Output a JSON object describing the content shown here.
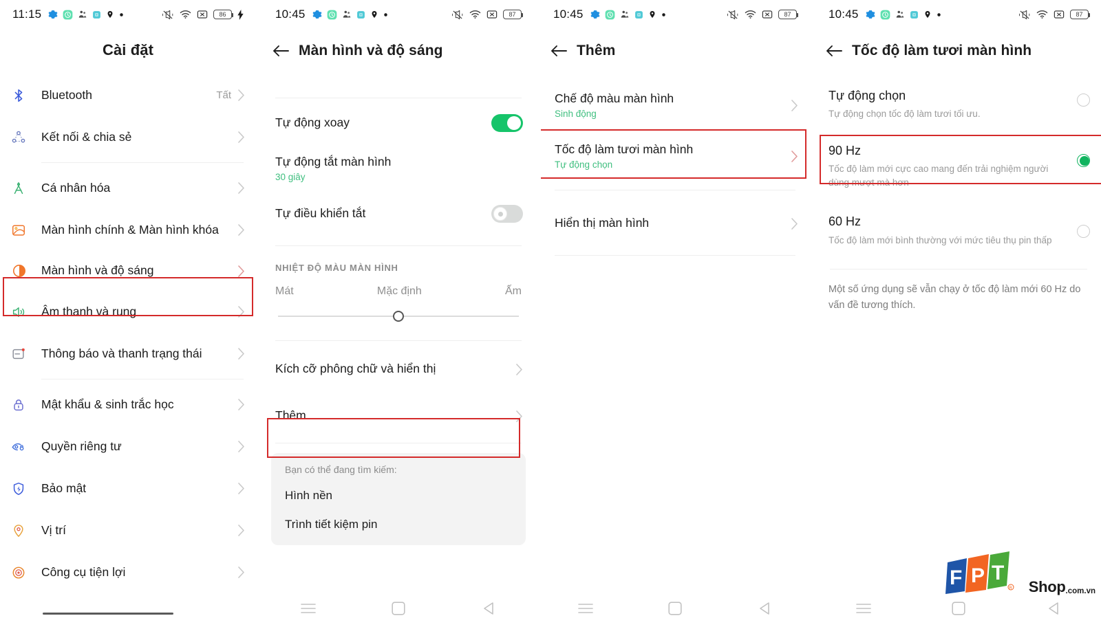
{
  "statusbars": {
    "panel1": {
      "time": "11:15",
      "battery": "86",
      "charging": true,
      "left_icons": [
        "gear-icon",
        "green-circle-icon",
        "people-icon",
        "teal-square-icon",
        "location-pin-icon",
        "dot-icon"
      ],
      "right_icons": [
        "mute-icon",
        "wifi-icon",
        "no-sim-icon",
        "battery-icon",
        "bolt-icon"
      ]
    },
    "panel2": {
      "time": "10:45",
      "battery": "87",
      "charging": false,
      "left_icons": [
        "gear-icon",
        "green-circle-icon",
        "people-icon",
        "teal-square-icon",
        "location-pin-icon",
        "dot-icon"
      ],
      "right_icons": [
        "mute-icon",
        "wifi-icon",
        "no-sim-icon",
        "battery-icon"
      ]
    },
    "panel3": {
      "time": "10:45",
      "battery": "87",
      "charging": false
    },
    "panel4": {
      "time": "10:45",
      "battery": "87",
      "charging": false
    }
  },
  "panel1": {
    "title": "Cài đặt",
    "items": [
      {
        "label": "Bluetooth",
        "value": "Tất",
        "icon": "bluetooth-icon"
      },
      {
        "label": "Kết nối & chia sẻ",
        "value": "",
        "icon": "connection-share-icon"
      },
      {
        "label": "Cá nhân hóa",
        "value": "",
        "icon": "compass-icon"
      },
      {
        "label": "Màn hình chính & Màn hình khóa",
        "value": "",
        "icon": "wallpaper-icon"
      },
      {
        "label": "Màn hình và độ sáng",
        "value": "",
        "icon": "brightness-icon"
      },
      {
        "label": "Âm thanh và rung",
        "value": "",
        "icon": "speaker-icon"
      },
      {
        "label": "Thông báo và thanh trạng thái",
        "value": "",
        "icon": "notification-icon"
      },
      {
        "label": "Mật khẩu & sinh trắc học",
        "value": "",
        "icon": "lock-icon"
      },
      {
        "label": "Quyền riêng tư",
        "value": "",
        "icon": "privacy-eye-icon"
      },
      {
        "label": "Bảo mật",
        "value": "",
        "icon": "shield-icon"
      },
      {
        "label": "Vị trí",
        "value": "",
        "icon": "location-pin-icon"
      },
      {
        "label": "Công cụ tiện lợi",
        "value": "",
        "icon": "tools-icon"
      }
    ],
    "highlight_index": 4
  },
  "panel2": {
    "title": "Màn hình và độ sáng",
    "auto_rotate": {
      "label": "Tự động xoay",
      "state": "on"
    },
    "screen_timeout": {
      "label": "Tự động tắt màn hình",
      "value": "30 giây"
    },
    "auto_off": {
      "label": "Tự điều khiển tắt",
      "state": "off"
    },
    "section_header": "NHIỆT ĐỘ MÀU MÀN HÌNH",
    "slider": {
      "left": "Mát",
      "center": "Mặc định",
      "right": "Ấm",
      "position_percent": 50
    },
    "font_size": {
      "label": "Kích cỡ phông chữ và hiển thị"
    },
    "more": {
      "label": "Thêm"
    },
    "suggestion": {
      "header": "Bạn có thể đang tìm kiếm:",
      "items": [
        "Hình nền",
        "Trình tiết kiệm pin"
      ]
    }
  },
  "panel3": {
    "title": "Thêm",
    "items": [
      {
        "label": "Chế độ màu màn hình",
        "sub": "Sinh động"
      },
      {
        "label": "Tốc độ làm tươi màn hình",
        "sub": "Tự động chọn"
      },
      {
        "label": "Hiển thị màn hình",
        "sub": ""
      }
    ],
    "highlight_index": 1
  },
  "panel4": {
    "title": "Tốc độ làm tươi màn hình",
    "options": [
      {
        "title": "Tự động chọn",
        "desc": "Tự động chọn tốc độ làm tươi tối ưu.",
        "selected": false
      },
      {
        "title": "90 Hz",
        "desc": "Tốc độ làm mới cực cao mang đến trải nghiệm người dùng mượt mà hơn",
        "selected": true
      },
      {
        "title": "60 Hz",
        "desc": "Tốc độ làm mới bình thường với mức tiêu thụ pin thấp",
        "selected": false
      }
    ],
    "note": "Một số ứng dụng sẽ vẫn chạy ở tốc độ làm mới 60 Hz do vấn đề tương thích.",
    "highlight_index": 1
  },
  "navbar": {
    "recents": "menu-icon",
    "home": "square-icon",
    "back": "triangle-back-icon"
  },
  "watermark": {
    "brand_f": "F",
    "brand_p": "P",
    "brand_t": "T",
    "shop": "Shop",
    "domain": ".com.vn"
  },
  "colors": {
    "accent_green": "#16c46a",
    "highlight_red": "#d42a2a",
    "subtext_green": "#3fbf7f",
    "chevron_gray": "#c9c9c9"
  }
}
